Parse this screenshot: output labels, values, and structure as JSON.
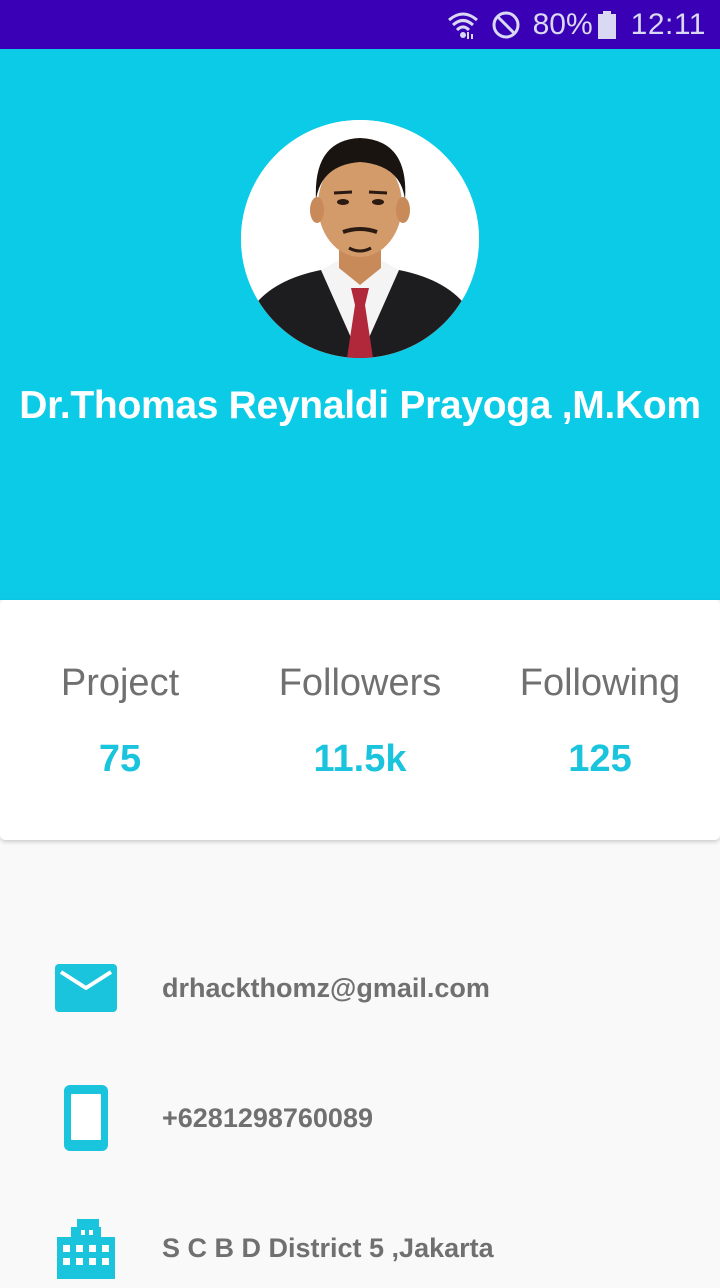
{
  "status_bar": {
    "battery": "80%",
    "time": "12:11",
    "icons": [
      "wifi-icon",
      "do-not-disturb-icon",
      "battery-icon"
    ]
  },
  "profile": {
    "name": "Dr.Thomas Reynaldi Prayoga ,M.Kom",
    "avatar": "profile-photo"
  },
  "stats": [
    {
      "label": "Project",
      "value": "75"
    },
    {
      "label": "Followers",
      "value": "11.5k"
    },
    {
      "label": "Following",
      "value": "125"
    }
  ],
  "contact": {
    "email": {
      "icon": "email-icon",
      "text": "drhackthomz@gmail.com"
    },
    "phone": {
      "icon": "phone-icon",
      "text": "+6281298760089"
    },
    "address": {
      "icon": "building-icon",
      "text": "S C B D District 5 ,Jakarta"
    }
  },
  "colors": {
    "status_bar": "#3a00b5",
    "header": "#0bcbe6",
    "accent": "#1ac4dd",
    "label_text": "#707070",
    "background": "#f9f9f9"
  }
}
